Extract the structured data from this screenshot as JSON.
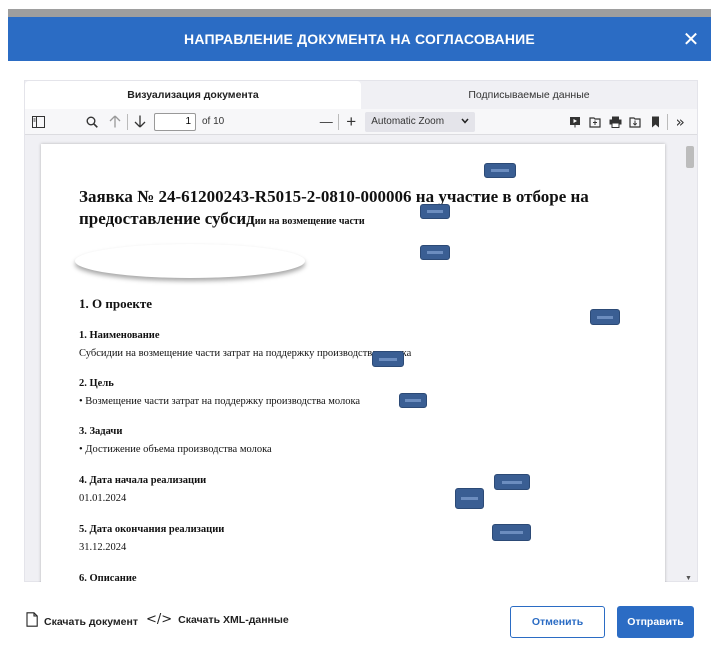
{
  "modal": {
    "title": "НАПРАВЛЕНИЕ ДОКУМЕНТА НА СОГЛАСОВАНИЕ",
    "close_glyph": "✕",
    "accent_color": "#2b6cc4"
  },
  "tabs": [
    {
      "label": "Визуализация документа",
      "active": true
    },
    {
      "label": "Подписываемые данные",
      "active": false
    }
  ],
  "toolbar": {
    "current_page": "1",
    "page_count_text": "of 10",
    "zoom_label": "Automatic Zoom",
    "zoom_out_glyph": "—",
    "zoom_in_glyph": "+",
    "more_glyph": "»"
  },
  "document": {
    "title_main": "Заявка № 24-61200243-R5015-2-0810-000006 на участие в отборе на предоставление субсид",
    "title_small": "ии на возмещение части",
    "section1": "1. О проекте",
    "items": [
      {
        "heading": "1. Наименование",
        "value": "Субсидии на возмещение части затрат на поддержку производства молока"
      },
      {
        "heading": "2. Цель",
        "value": "• Возмещение части затрат на поддержку производства молока"
      },
      {
        "heading": "3. Задачи",
        "value": "• Достижение объема производства молока"
      },
      {
        "heading": "4. Дата начала реализации",
        "value": "01.01.2024"
      },
      {
        "heading": "5. Дата окончания реализации",
        "value": "31.12.2024"
      },
      {
        "heading": "6. Описание",
        "value": ""
      }
    ]
  },
  "footer": {
    "download_doc": "Скачать документ",
    "download_xml": "Скачать XML-данные",
    "xml_glyph": "</>",
    "cancel": "Отменить",
    "send": "Отправить"
  }
}
